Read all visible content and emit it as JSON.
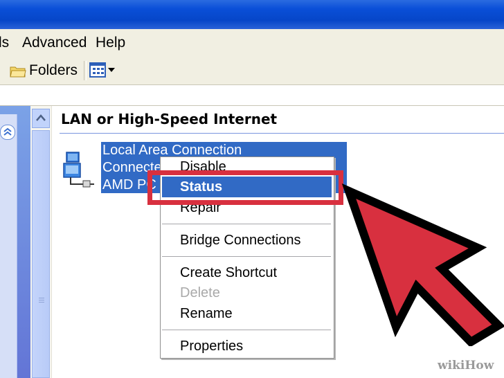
{
  "menu": {
    "items": [
      "ls",
      "Advanced",
      "Help"
    ]
  },
  "toolbar": {
    "folders_label": "Folders",
    "views_icon": "views-icon"
  },
  "content": {
    "group_title": "LAN or High-Speed Internet",
    "connection": {
      "name": "Local Area Connection",
      "status_line": "Connecte",
      "device_line": "AMD PC"
    }
  },
  "context_menu": {
    "items": [
      {
        "label": "Disable",
        "enabled": true
      },
      {
        "label": "Status",
        "enabled": true,
        "highlighted": true
      },
      {
        "label": "Repair",
        "enabled": true
      },
      {
        "label": "Bridge Connections",
        "enabled": true
      },
      {
        "label": "Create Shortcut",
        "enabled": true
      },
      {
        "label": "Delete",
        "enabled": false
      },
      {
        "label": "Rename",
        "enabled": true
      },
      {
        "label": "Properties",
        "enabled": true
      }
    ]
  },
  "colors": {
    "titlebar": "#0a4fd8",
    "selection": "#316ac5",
    "annotation_red": "#d8303f"
  },
  "watermark": "wikiHow"
}
